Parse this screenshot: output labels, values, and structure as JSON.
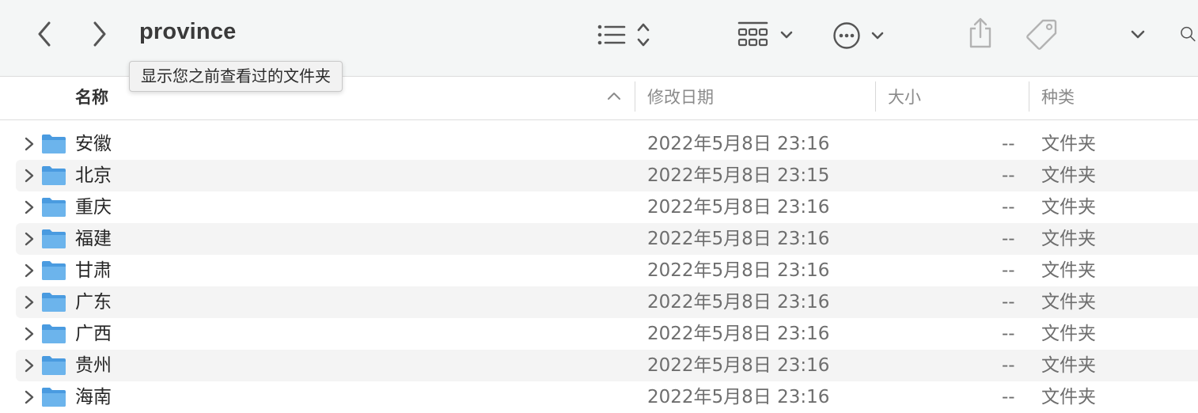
{
  "window": {
    "title": "province",
    "tooltip": "显示您之前查看过的文件夹"
  },
  "colors": {
    "folder_blue": "#6cb4ec",
    "toolbar_bg": "#f4f6f6",
    "alt_row": "#f4f4f4"
  },
  "toolbar_icons": [
    "chevron-left-icon",
    "chevron-right-icon",
    "list-view-icon",
    "gallery-grid-icon",
    "more-actions-icon",
    "share-icon",
    "tag-icon",
    "chevron-down-icon",
    "search-icon"
  ],
  "columns": {
    "name": "名称",
    "date": "修改日期",
    "size": "大小",
    "kind": "种类"
  },
  "rows": [
    {
      "name": "安徽",
      "date": "2022年5月8日 23:16",
      "size": "--",
      "kind": "文件夹"
    },
    {
      "name": "北京",
      "date": "2022年5月8日 23:15",
      "size": "--",
      "kind": "文件夹"
    },
    {
      "name": "重庆",
      "date": "2022年5月8日 23:16",
      "size": "--",
      "kind": "文件夹"
    },
    {
      "name": "福建",
      "date": "2022年5月8日 23:16",
      "size": "--",
      "kind": "文件夹"
    },
    {
      "name": "甘肃",
      "date": "2022年5月8日 23:16",
      "size": "--",
      "kind": "文件夹"
    },
    {
      "name": "广东",
      "date": "2022年5月8日 23:16",
      "size": "--",
      "kind": "文件夹"
    },
    {
      "name": "广西",
      "date": "2022年5月8日 23:16",
      "size": "--",
      "kind": "文件夹"
    },
    {
      "name": "贵州",
      "date": "2022年5月8日 23:16",
      "size": "--",
      "kind": "文件夹"
    },
    {
      "name": "海南",
      "date": "2022年5月8日 23:16",
      "size": "--",
      "kind": "文件夹"
    }
  ]
}
